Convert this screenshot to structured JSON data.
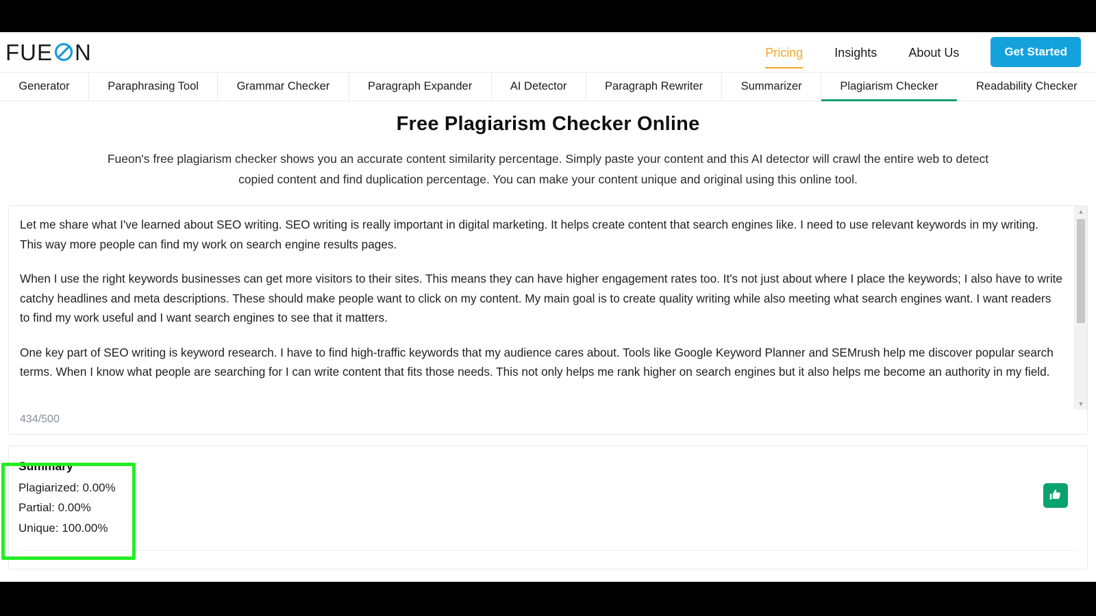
{
  "brand": {
    "name_before": "FUE",
    "name_after": "N",
    "logo_icon": "fueon-circle-slash-logo",
    "accent_blue": "#14a2dc"
  },
  "header": {
    "nav": [
      {
        "label": "Pricing",
        "active": true
      },
      {
        "label": "Insights",
        "active": false
      },
      {
        "label": "About Us",
        "active": false
      }
    ],
    "cta_label": "Get Started",
    "active_color": "#f5a524"
  },
  "tabs": [
    {
      "label": "Generator",
      "active": false
    },
    {
      "label": "Paraphrasing Tool",
      "active": false
    },
    {
      "label": "Grammar Checker",
      "active": false
    },
    {
      "label": "Paragraph Expander",
      "active": false
    },
    {
      "label": "AI Detector",
      "active": false
    },
    {
      "label": "Paragraph Rewriter",
      "active": false
    },
    {
      "label": "Summarizer",
      "active": false
    },
    {
      "label": "Plagiarism Checker",
      "active": true
    },
    {
      "label": "Readability Checker",
      "active": false
    }
  ],
  "tabs_active_color": "#16a06a",
  "hero": {
    "title": "Free Plagiarism Checker Online",
    "description_line1": "Fueon's free plagiarism checker shows you an accurate content similarity percentage. Simply paste your content and this AI detector will crawl",
    "description_line2": "the entire web to detect copied content and find duplication percentage. You can make your content unique and original using this online tool."
  },
  "editor": {
    "paragraph1": "Let me share what I've learned about SEO writing. SEO writing is really important in digital marketing. It helps create content that search engines like. I need to use relevant keywords in my writing. This way  more people can find my work on search engine results pages.",
    "paragraph2": "When I use the right keywords  businesses can get more visitors to their sites. This means they can have higher engagement rates too. It's not just about where I place the keywords; I also have to write catchy headlines and meta descriptions. These should make people want to click on my content. My main goal is to create quality writing while also meeting what search engines want. I want readers to find my work useful  and I want search engines to see that it matters.",
    "paragraph3": "One key part of SEO writing is keyword research. I have to find high-traffic keywords that my audience cares about. Tools like Google Keyword Planner and SEMrush help me discover popular search terms. When I know what people are searching for  I can write content that fits those needs. This not only helps me rank higher on search engines  but it also helps me become an authority in my field.",
    "char_count": "434/500",
    "scrollbar_up_icon": "chevron-up-icon",
    "scrollbar_down_icon": "chevron-down-icon"
  },
  "results": {
    "summary_title": "Summary",
    "plagiarized": "Plagiarized: 0.00%",
    "partial": "Partial: 0.00%",
    "unique": "Unique: 100.00%",
    "like_icon": "thumbs-up-icon",
    "like_color": "#09a36d",
    "highlight_color": "#24ed24"
  }
}
